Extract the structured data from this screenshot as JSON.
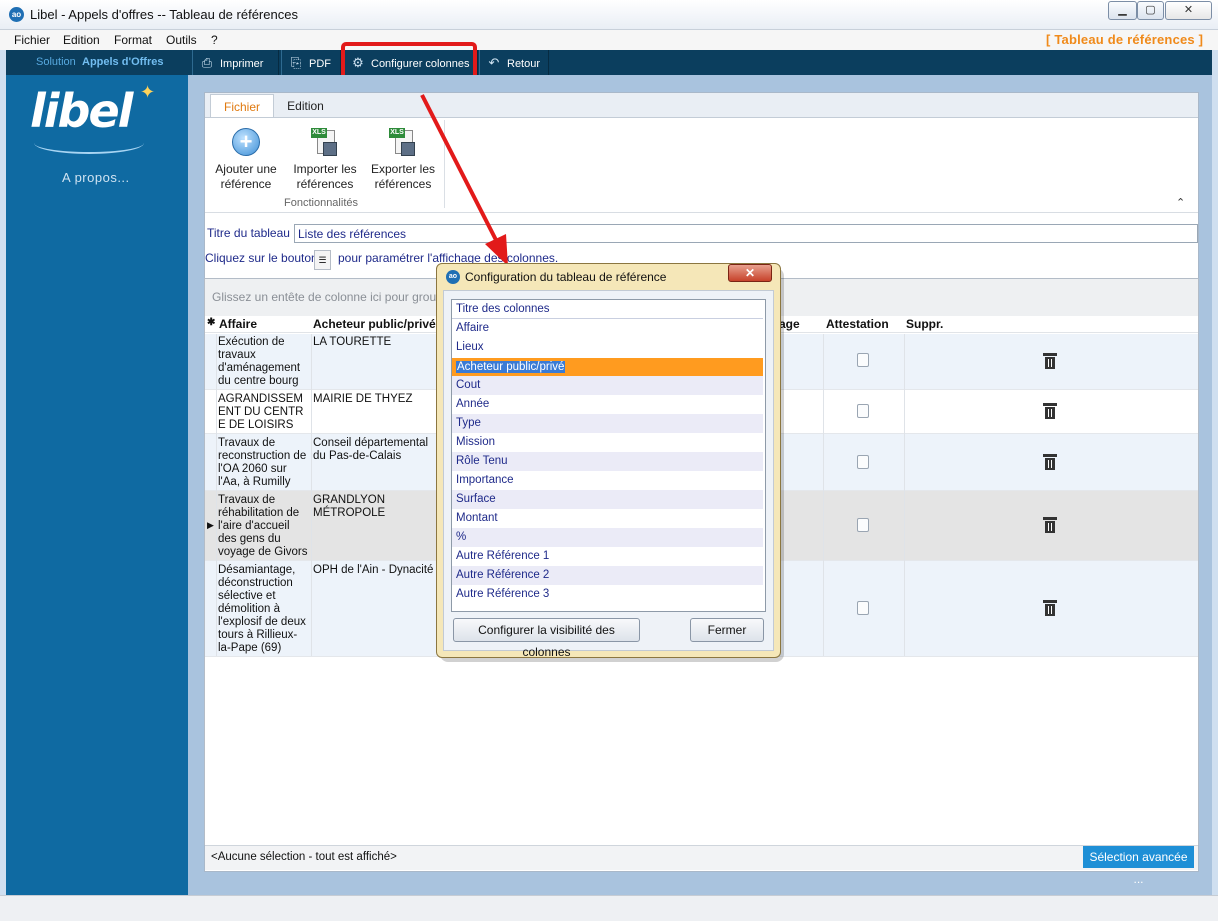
{
  "window": {
    "title": "Libel - Appels d'offres -- Tableau de références",
    "app_icon": "ao",
    "min": "▁",
    "max": "▢",
    "close": "✕"
  },
  "menu": {
    "items": [
      "Fichier",
      "Edition",
      "Format",
      "Outils",
      "?"
    ],
    "screen_title": "[ Tableau de références ]"
  },
  "toolbar": {
    "solution_label": "Solution",
    "solution_name": "Appels d'Offres",
    "buttons": [
      {
        "label": "Imprimer",
        "icon": "printer-icon"
      },
      {
        "label": "PDF",
        "icon": "pdf-icon"
      },
      {
        "label": "Configurer colonnes",
        "icon": "gears-icon"
      },
      {
        "label": "Retour",
        "icon": "undo-icon"
      }
    ]
  },
  "sidebar": {
    "logo": "libel",
    "apropos": "A propos..."
  },
  "ribbon": {
    "tabs": [
      "Fichier",
      "Edition"
    ],
    "buttons": [
      {
        "line1": "Ajouter une",
        "line2": "référence"
      },
      {
        "line1": "Importer les",
        "line2": "références"
      },
      {
        "line1": "Exporter les",
        "line2": "références"
      }
    ],
    "xls_tag": "XLS",
    "group_label": "Fonctionnalités",
    "collapse": "⌃"
  },
  "form": {
    "titre_label": "Titre du tableau :",
    "titre_value": "Liste des références",
    "clic_label": "Cliquez sur le bouton",
    "clic_label2": "pour paramétrer l'affichage des colonnes."
  },
  "grid": {
    "group_hint": "Glissez un entête de colonne ici pour grouper le",
    "row_marker": "✱",
    "columns": [
      "Affaire",
      "Acheteur public/privé",
      "age",
      "Attestation",
      "Suppr."
    ],
    "rows": [
      {
        "affaire": "Exécution de travaux d'aménagement du centre bourg",
        "acheteur": "LA TOURETTE"
      },
      {
        "affaire": "AGRANDISSEMENT DU CENTRE DE LOISIRS",
        "acheteur": "MAIRIE DE THYEZ"
      },
      {
        "affaire": "Travaux de reconstruction de l'OA 2060 sur l'Aa, à Rumilly",
        "acheteur": "Conseil départemental du Pas-de-Calais"
      },
      {
        "affaire": "Travaux de réhabilitation de l'aire d'accueil des gens du voyage de Givors",
        "acheteur": "GRANDLYON MÉTROPOLE"
      },
      {
        "affaire": "Désamiantage, déconstruction sélective et démolition à l'explosif de deux tours à Rillieux-la-Pape (69)",
        "acheteur": "OPH de l'Ain - Dynacité"
      }
    ],
    "footer_text": "<Aucune sélection - tout est affiché>",
    "advanced_selection": "Sélection avancée ..."
  },
  "dialog": {
    "icon": "ao",
    "title": "Configuration du tableau de référence",
    "close": "✕",
    "list_items": [
      "Titre des colonnes",
      "Affaire",
      "Lieux",
      "Acheteur public/privé",
      "Cout",
      "Année",
      "Type",
      "Mission",
      "Rôle Tenu",
      "Importance",
      "Surface",
      "Montant",
      "%",
      "Autre Référence 1",
      "Autre Référence 2",
      "Autre Référence 3"
    ],
    "selected_index": 3,
    "btn_config": "Configurer la visibilité des colonnes",
    "btn_close": "Fermer"
  },
  "colors": {
    "toolbar": "#0b3e5e",
    "sidebar": "#0f6aa2",
    "accent_orange": "#f08a1a",
    "highlight_red": "#e21a1a",
    "dialog_frame": "#f5e7b8",
    "selection_orange": "#ff9b1f"
  }
}
